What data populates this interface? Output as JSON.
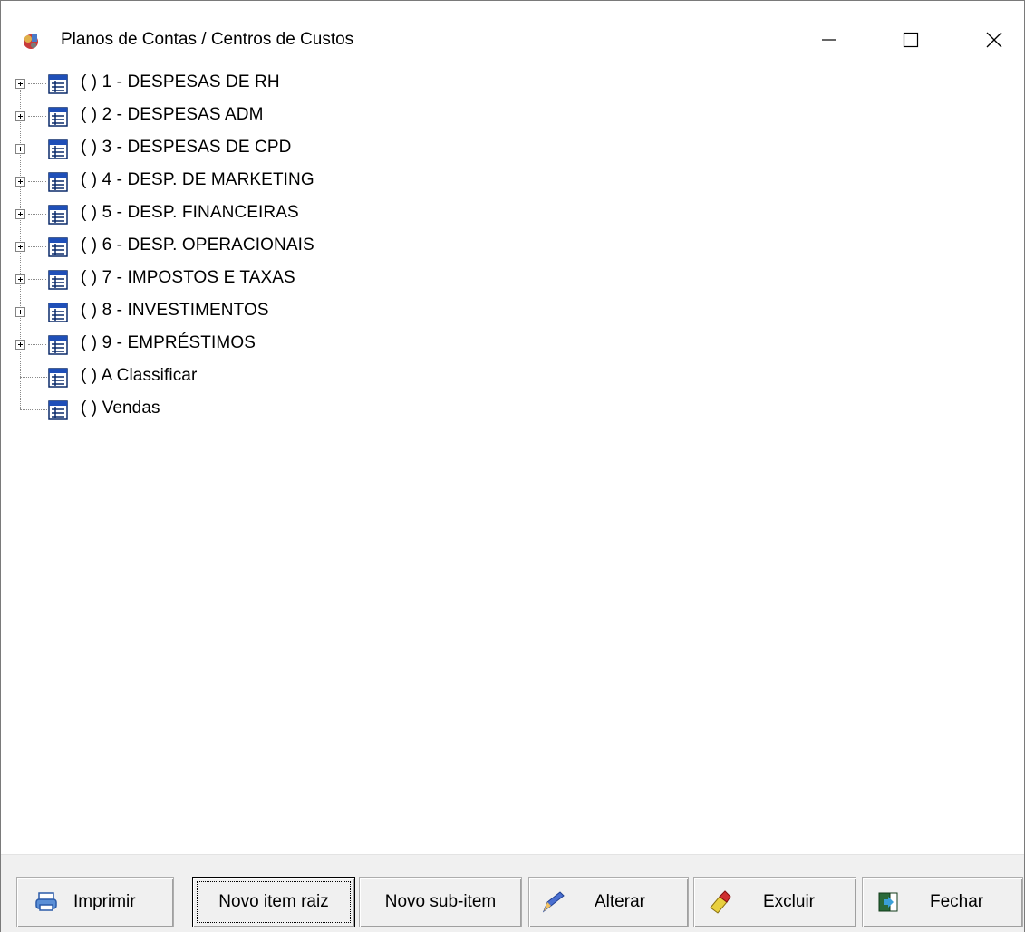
{
  "window": {
    "title": "Planos de Contas / Centros de Custos",
    "minimize_glyph": "minimize-icon",
    "maximize_glyph": "maximize-icon",
    "close_glyph": "close-icon"
  },
  "tree": {
    "items": [
      {
        "label": "( ) 1 - DESPESAS DE RH",
        "expandable": true
      },
      {
        "label": "( ) 2 - DESPESAS ADM",
        "expandable": true
      },
      {
        "label": "( ) 3 - DESPESAS DE CPD",
        "expandable": true
      },
      {
        "label": "( ) 4 - DESP. DE MARKETING",
        "expandable": true
      },
      {
        "label": "( ) 5 - DESP. FINANCEIRAS",
        "expandable": true
      },
      {
        "label": "( ) 6 - DESP. OPERACIONAIS",
        "expandable": true
      },
      {
        "label": "( ) 7 - IMPOSTOS E TAXAS",
        "expandable": true
      },
      {
        "label": "( ) 8 - INVESTIMENTOS",
        "expandable": true
      },
      {
        "label": "( ) 9 - EMPRÉSTIMOS",
        "expandable": true
      },
      {
        "label": "( ) A Classificar",
        "expandable": false
      },
      {
        "label": "( ) Vendas",
        "expandable": false
      }
    ]
  },
  "buttons": {
    "print": "Imprimir",
    "new_root": "Novo item raiz",
    "new_sub": "Novo sub-item",
    "edit": "Alterar",
    "delete": "Excluir",
    "close_prefix": "F",
    "close_rest": "echar"
  }
}
